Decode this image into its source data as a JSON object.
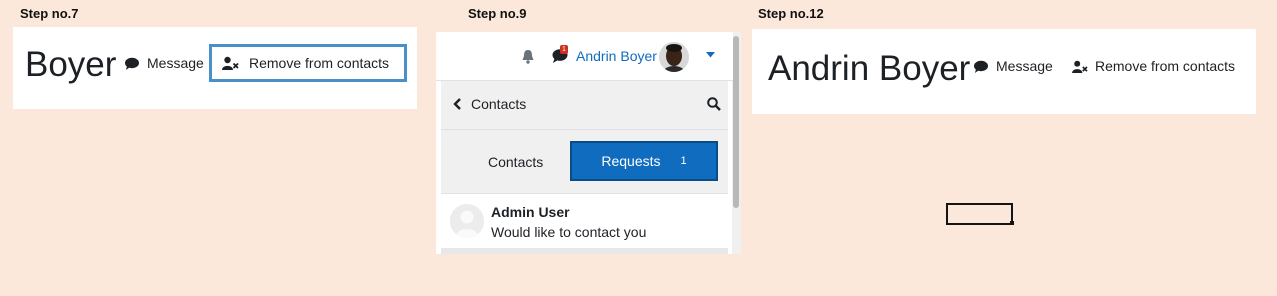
{
  "steps": {
    "step7_label": "Step no.7",
    "step9_label": "Step no.9",
    "step12_label": "Step no.12"
  },
  "panel1": {
    "name": "Boyer",
    "message_label": "Message",
    "remove_label": "Remove from contacts",
    "icons": [
      "chat-icon",
      "user-remove-icon"
    ]
  },
  "panel2": {
    "notification_count": "1",
    "user_name": "Andrin Boyer",
    "contacts_title": "Contacts",
    "tabs": {
      "contacts": "Contacts",
      "requests": "Requests",
      "requests_count": "1"
    },
    "request": {
      "name": "Admin User",
      "message": "Would like to contact you"
    },
    "icons": [
      "bell-icon",
      "chat-icon",
      "chevron-left-icon",
      "search-icon",
      "caret-down-icon"
    ],
    "colors": {
      "link": "#0f6cbf",
      "badge": "#ca3120",
      "active_tab": "#0f6cbf"
    }
  },
  "panel3": {
    "name": "Andrin Boyer",
    "message_label": "Message",
    "remove_label": "Remove from contacts"
  }
}
